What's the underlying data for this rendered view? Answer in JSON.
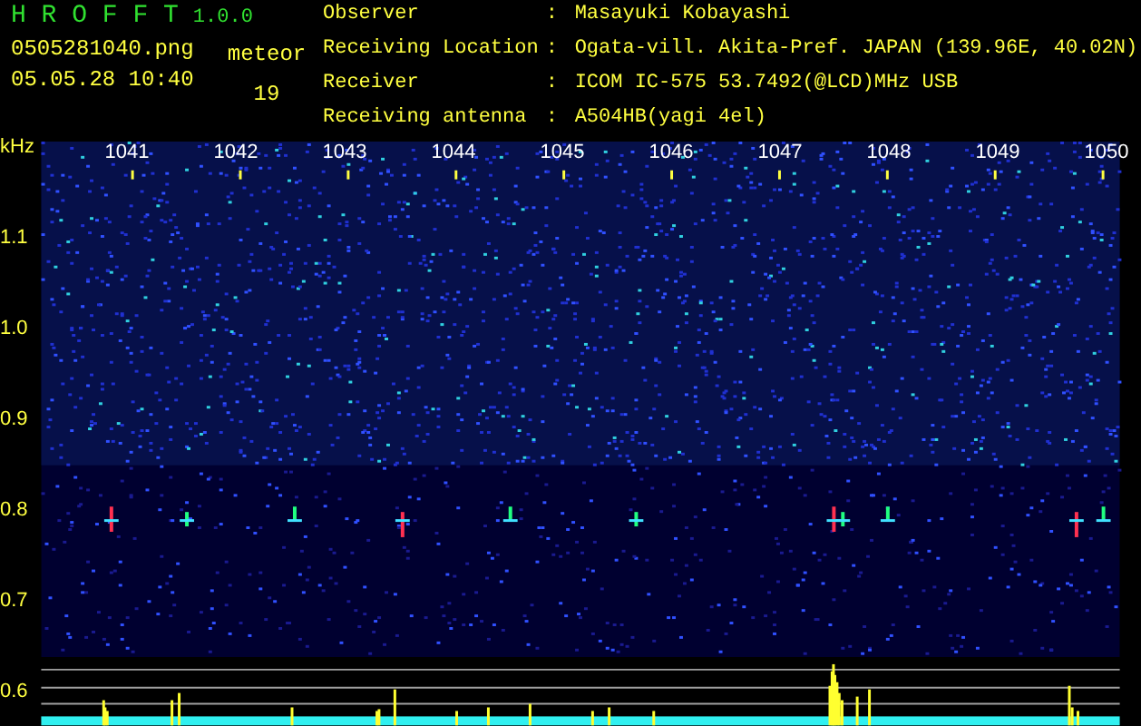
{
  "app": {
    "name": "H R O F F T",
    "version": "1.0.0"
  },
  "file": {
    "name": "0505281040.png",
    "datetime": "05.05.28 10:40"
  },
  "count": {
    "label": "meteor",
    "value": "19"
  },
  "info": [
    {
      "label": "Observer",
      "separator": ":",
      "value": "Masayuki Kobayashi"
    },
    {
      "label": "Receiving Location",
      "separator": ":",
      "value": "Ogata-vill. Akita-Pref. JAPAN (139.96E, 40.02N)"
    },
    {
      "label": "Receiver",
      "separator": ":",
      "value": "ICOM IC-575 53.7492(@LCD)MHz USB"
    },
    {
      "label": "Receiving antenna",
      "separator": ":",
      "value": "A504HB(yagi 4el)"
    }
  ],
  "plot": {
    "unit": "kHz",
    "y_labels": [
      "1.1",
      "1.0",
      "0.9",
      "0.8",
      "0.7",
      "0.6"
    ],
    "x_labels": [
      "1041",
      "1042",
      "1043",
      "1044",
      "1045",
      "1046",
      "1047",
      "1048",
      "1049",
      "1050"
    ]
  }
}
